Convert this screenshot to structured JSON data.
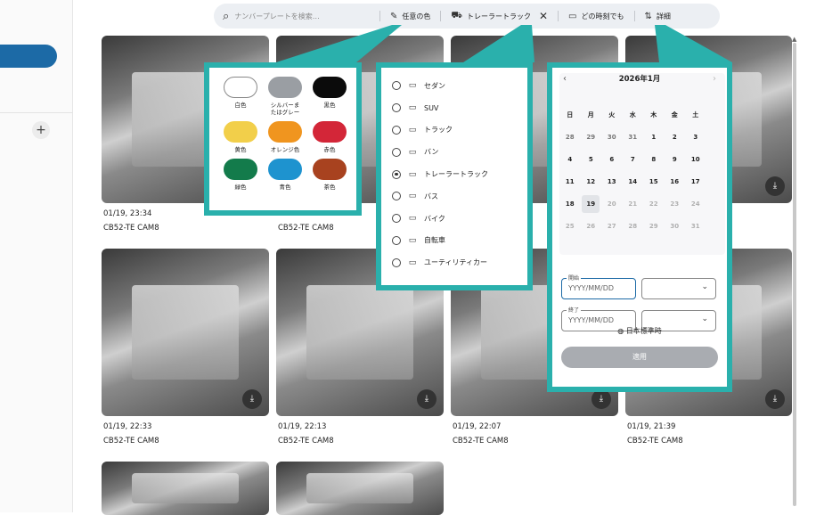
{
  "search": {
    "placeholder": "ナンバープレートを検索…"
  },
  "filters": {
    "color": "任意の色",
    "vehicle": "トレーラートラック",
    "time": "どの時刻でも",
    "detail": "詳細"
  },
  "colors": [
    {
      "label": "白色",
      "hex": "#ffffff"
    },
    {
      "label": "シルバーまたはグレー",
      "hex": "#9a9ea3"
    },
    {
      "label": "黒色",
      "hex": "#0b0b0b"
    },
    {
      "label": "黄色",
      "hex": "#f2cf4a"
    },
    {
      "label": "オレンジ色",
      "hex": "#f0951f"
    },
    {
      "label": "赤色",
      "hex": "#d32638"
    },
    {
      "label": "緑色",
      "hex": "#137b4b"
    },
    {
      "label": "青色",
      "hex": "#1e93cf"
    },
    {
      "label": "茶色",
      "hex": "#a8421f"
    }
  ],
  "vehicles": [
    {
      "label": "セダン",
      "icon": "sedan-icon",
      "selected": false
    },
    {
      "label": "SUV",
      "icon": "suv-icon",
      "selected": false
    },
    {
      "label": "トラック",
      "icon": "truck-icon",
      "selected": false
    },
    {
      "label": "バン",
      "icon": "van-icon",
      "selected": false
    },
    {
      "label": "トレーラートラック",
      "icon": "trailer-truck-icon",
      "selected": true
    },
    {
      "label": "バス",
      "icon": "bus-icon",
      "selected": false
    },
    {
      "label": "バイク",
      "icon": "motorbike-icon",
      "selected": false
    },
    {
      "label": "自転車",
      "icon": "bicycle-icon",
      "selected": false
    },
    {
      "label": "ユーティリティカー",
      "icon": "utility-car-icon",
      "selected": false
    }
  ],
  "calendar": {
    "month_label": "2026年1月",
    "weekdays": [
      "日",
      "月",
      "火",
      "水",
      "木",
      "金",
      "土"
    ],
    "days": [
      [
        "28",
        "29",
        "30",
        "31",
        "1",
        "2",
        "3"
      ],
      [
        "4",
        "5",
        "6",
        "7",
        "8",
        "9",
        "10"
      ],
      [
        "11",
        "12",
        "13",
        "14",
        "15",
        "16",
        "17"
      ],
      [
        "18",
        "19",
        "20",
        "21",
        "22",
        "23",
        "24"
      ],
      [
        "25",
        "26",
        "27",
        "28",
        "29",
        "30",
        "31"
      ]
    ],
    "selected_day": "19",
    "start_label": "開始",
    "end_label": "終了",
    "date_placeholder": "YYYY/MM/DD",
    "timezone": "日本標準時",
    "apply": "適用"
  },
  "results": [
    {
      "time": "01/19, 23:34",
      "camera": "CB52-TE CAM8"
    },
    {
      "time": "",
      "camera": "CB52-TE CAM8"
    },
    {
      "time": "",
      "camera": ""
    },
    {
      "time": "",
      "camera": ""
    },
    {
      "time": "01/19, 22:33",
      "camera": "CB52-TE CAM8"
    },
    {
      "time": "01/19, 22:13",
      "camera": "CB52-TE CAM8"
    },
    {
      "time": "01/19, 22:07",
      "camera": "CB52-TE CAM8"
    },
    {
      "time": "01/19, 21:39",
      "camera": "CB52-TE CAM8"
    }
  ]
}
